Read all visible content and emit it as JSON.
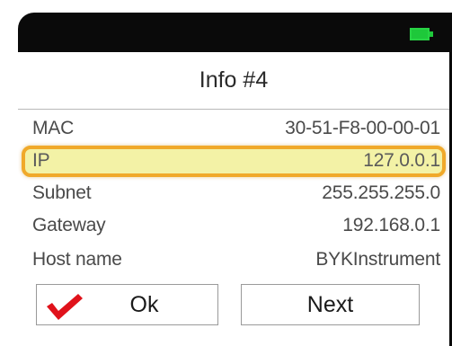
{
  "status": {
    "battery_icon": "battery-full-icon",
    "battery_color": "#1ec83a"
  },
  "screen": {
    "title": "Info #4",
    "rows": [
      {
        "label": "MAC",
        "value": "30-51-F8-00-00-01"
      },
      {
        "label": "IP",
        "value": "127.0.0.1"
      },
      {
        "label": "Subnet",
        "value": "255.255.255.0"
      },
      {
        "label": "Gateway",
        "value": "192.168.0.1"
      },
      {
        "label": "Host name",
        "value": "BYKInstrument"
      }
    ],
    "highlight_color": "#f0a92a",
    "highlight_fill": "#f3f2a6"
  },
  "buttons": {
    "ok_label": "Ok",
    "ok_icon": "checkmark-icon",
    "ok_icon_color": "#e0121b",
    "next_label": "Next"
  }
}
